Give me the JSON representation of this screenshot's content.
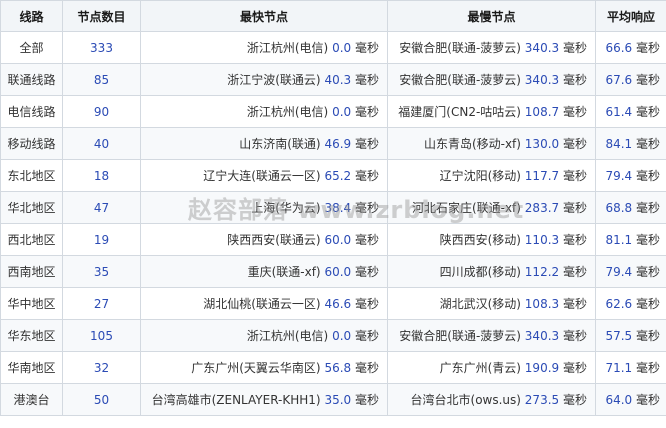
{
  "headers": {
    "line": "线路",
    "count": "节点数目",
    "fastest": "最快节点",
    "slowest": "最慢节点",
    "average": "平均响应"
  },
  "unit": "毫秒",
  "watermark": "赵容部落 www.zrblog.net",
  "rows": [
    {
      "line": "全部",
      "count": "333",
      "fast_name": "浙江杭州(电信)",
      "fast_ms": "0.0",
      "slow_name": "安徽合肥(联通-菠萝云)",
      "slow_ms": "340.3",
      "avg": "66.6"
    },
    {
      "line": "联通线路",
      "count": "85",
      "fast_name": "浙江宁波(联通云)",
      "fast_ms": "40.3",
      "slow_name": "安徽合肥(联通-菠萝云)",
      "slow_ms": "340.3",
      "avg": "67.6"
    },
    {
      "line": "电信线路",
      "count": "90",
      "fast_name": "浙江杭州(电信)",
      "fast_ms": "0.0",
      "slow_name": "福建厦门(CN2-咕咕云)",
      "slow_ms": "108.7",
      "avg": "61.4"
    },
    {
      "line": "移动线路",
      "count": "40",
      "fast_name": "山东济南(联通)",
      "fast_ms": "46.9",
      "slow_name": "山东青岛(移动-xf)",
      "slow_ms": "130.0",
      "avg": "84.1"
    },
    {
      "line": "东北地区",
      "count": "18",
      "fast_name": "辽宁大连(联通云一区)",
      "fast_ms": "65.2",
      "slow_name": "辽宁沈阳(移动)",
      "slow_ms": "117.7",
      "avg": "79.4"
    },
    {
      "line": "华北地区",
      "count": "47",
      "fast_name": "上海(华为云)",
      "fast_ms": "38.4",
      "slow_name": "河北石家庄(联通-xf)",
      "slow_ms": "283.7",
      "avg": "68.8"
    },
    {
      "line": "西北地区",
      "count": "19",
      "fast_name": "陕西西安(联通云)",
      "fast_ms": "60.0",
      "slow_name": "陕西西安(移动)",
      "slow_ms": "110.3",
      "avg": "81.1"
    },
    {
      "line": "西南地区",
      "count": "35",
      "fast_name": "重庆(联通-xf)",
      "fast_ms": "60.0",
      "slow_name": "四川成都(移动)",
      "slow_ms": "112.2",
      "avg": "79.4"
    },
    {
      "line": "华中地区",
      "count": "27",
      "fast_name": "湖北仙桃(联通云一区)",
      "fast_ms": "46.6",
      "slow_name": "湖北武汉(移动)",
      "slow_ms": "108.3",
      "avg": "62.6"
    },
    {
      "line": "华东地区",
      "count": "105",
      "fast_name": "浙江杭州(电信)",
      "fast_ms": "0.0",
      "slow_name": "安徽合肥(联通-菠萝云)",
      "slow_ms": "340.3",
      "avg": "57.5"
    },
    {
      "line": "华南地区",
      "count": "32",
      "fast_name": "广东广州(天翼云华南区)",
      "fast_ms": "56.8",
      "slow_name": "广东广州(青云)",
      "slow_ms": "190.9",
      "avg": "71.1"
    },
    {
      "line": "港澳台",
      "count": "50",
      "fast_name": "台湾高雄市(ZENLAYER-KHH1)",
      "fast_ms": "35.0",
      "slow_name": "台湾台北市(ows.us)",
      "slow_ms": "273.5",
      "avg": "64.0"
    }
  ]
}
